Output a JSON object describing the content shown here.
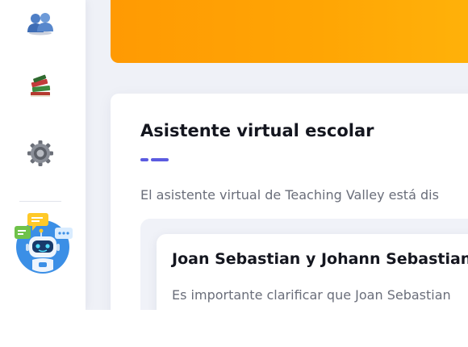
{
  "sidebar": {
    "items": [
      {
        "icon": "users-icon"
      },
      {
        "icon": "books-icon"
      },
      {
        "icon": "gear-icon"
      }
    ],
    "assistant": {
      "icon": "robot-assistant-icon"
    }
  },
  "colors": {
    "accent": "#5b5be0",
    "hero_start": "#ff9a03",
    "hero_end": "#ffb30a",
    "background": "#eff1f7"
  },
  "main": {
    "title": "Asistente virtual escolar",
    "description": "El asistente virtual de Teaching Valley está dis",
    "answer": {
      "title": "Joan Sebastian y Johann Sebastian E",
      "text": "Es importante clarificar que Joan Sebastian"
    }
  }
}
